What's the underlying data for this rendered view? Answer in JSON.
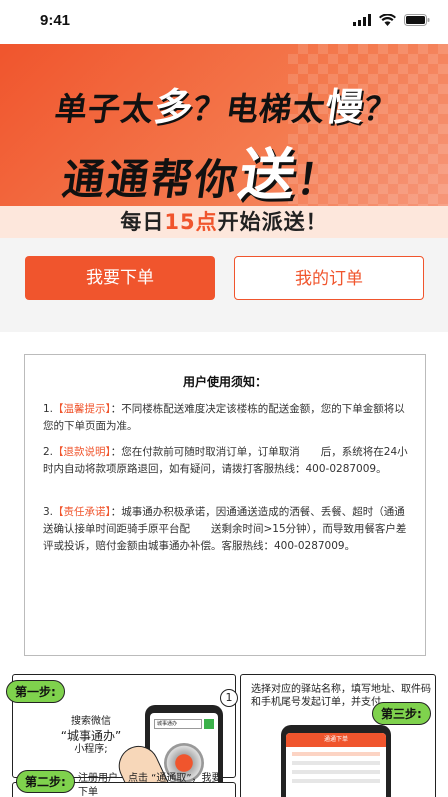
{
  "status_bar": {
    "time": "9:41"
  },
  "banner": {
    "line1_a": "单子太",
    "line1_b": "多",
    "line1_c": "？电梯太",
    "line1_d": "慢",
    "line1_e": "？",
    "line2_a": "通通帮你",
    "line2_b": "送",
    "line2_c": "！"
  },
  "daily": {
    "prefix": "每日",
    "num": "15点",
    "suffix": "开始派送！"
  },
  "buttons": {
    "place_order": "我要下单",
    "my_orders": "我的订单"
  },
  "notice": {
    "title": "用户使用须知：",
    "items": [
      {
        "num": "1.",
        "tag": "【温馨提示】",
        "text": "：不同楼栋配送难度决定该楼栋的配送金额，您的下单金额将以您的下单页面为准。"
      },
      {
        "num": "2.",
        "tag": "【退款说明】",
        "text": "：您在付款前可随时取消订单，订单取消　　后，系统将在24小时内自动将款项原路退回，如有疑问，请拨打客服热线：400-0287009。"
      },
      {
        "num": "3.",
        "tag": "【责任承诺】",
        "text": "：城事通办积极承诺，因通通送造成的洒餐、丢餐、超时（通通送确认接单时间距骑手原平台配　　送剩余时间>15分钟），而导致用餐客户差评或投诉，赔付金额由城事通办补偿。客服热线：400-0287009。"
      }
    ]
  },
  "guide": {
    "step1_badge": "第一步:",
    "step1_num": "1",
    "step1_text_a": "搜索微信",
    "step1_text_b": "“城事通办”",
    "step1_text_c": "小程序;",
    "step1_search": "城事通办",
    "step3_badge": "第三步:",
    "step3_text": "选择对应的驿站名称，填写地址、取件码和手机尾号发起订单，并支付",
    "step3_screen_title": "通通下单",
    "step2_badge": "第二步:",
    "step2_text": "注册用户　点击 “通通取”，我要下单"
  }
}
